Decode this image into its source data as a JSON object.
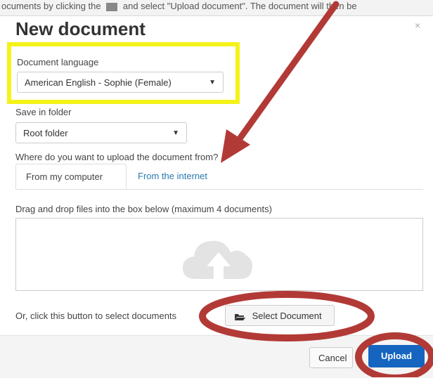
{
  "background_strip": {
    "text_left": "ocuments by clicking the",
    "text_right": "and select \"Upload document\". The document will then be"
  },
  "dialog": {
    "title": "New document",
    "close_glyph": "×",
    "language": {
      "label": "Document language",
      "value": "American English - Sophie (Female)"
    },
    "folder": {
      "label": "Save in folder",
      "value": "Root folder"
    },
    "source_question": "Where do you want to upload the document from?",
    "tabs": [
      {
        "label": "From my computer",
        "active": true
      },
      {
        "label": "From the internet",
        "active": false
      }
    ],
    "drop_zone": {
      "label": "Drag and drop files into the box below (maximum 4 documents)",
      "icon": "cloud-upload-icon"
    },
    "select_prompt": "Or, click this button to select documents",
    "select_button": "Select Document",
    "footer": {
      "cancel": "Cancel",
      "upload": "Upload"
    }
  },
  "annotations": {
    "highlight_color": "#f5f21a",
    "mark_color": "#b23a36"
  }
}
